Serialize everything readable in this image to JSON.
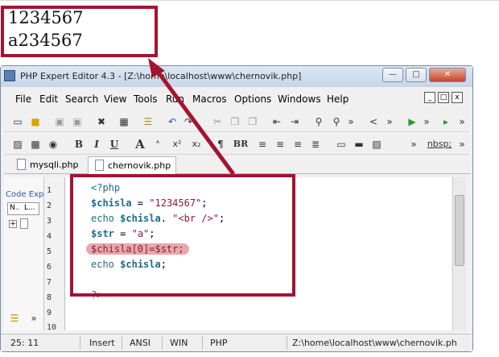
{
  "output_lines": [
    "1234567",
    "a234567"
  ],
  "window": {
    "title": "PHP Expert Editor 4.3 - [Z:\\home\\localhost\\www\\chernovik.php]",
    "controls": {
      "minimize": "—",
      "maximize": "□",
      "close": "✕"
    }
  },
  "menu": {
    "items": [
      "File",
      "Edit",
      "Search",
      "View",
      "Tools",
      "Run",
      "Macros",
      "Options",
      "Windows",
      "Help"
    ],
    "mdi": {
      "minimize": "_",
      "restore": "□",
      "close": "x"
    }
  },
  "toolbar2": {
    "bold": "B",
    "italic": "I",
    "underline": "U",
    "font_size": "A",
    "superscript": "x²",
    "subscript": "x₂",
    "paragraph": "¶",
    "br": "BR",
    "nbsp": "nbsp;"
  },
  "tabs": [
    {
      "label": "mysqli.php",
      "active": false
    },
    {
      "label": "chernovik.php",
      "active": true
    }
  ],
  "side_panel": {
    "label": "Code Exp",
    "col_n": "N..",
    "col_l": "L...",
    "expand": "+"
  },
  "line_numbers": [
    "1",
    "2",
    "3",
    "4",
    "5",
    "6",
    "7",
    "8",
    "9",
    "10"
  ],
  "code": {
    "l1": "<?php",
    "l2_var": "$chisla",
    "l2_op": " = ",
    "l2_str": "\"1234567\"",
    "l2_end": ";",
    "l3_kw": "echo",
    "l3_var": "$chisla",
    "l3_op": ". ",
    "l3_str": "\"<br />\"",
    "l3_end": ";",
    "l4_var": "$str",
    "l4_op": " = ",
    "l4_str": "\"a\"",
    "l4_end": ";",
    "l5": "$chisla[0]=$str;",
    "l6_kw": "echo",
    "l6_var": "$chisla",
    "l6_end": ";",
    "l8": "?>"
  },
  "status": {
    "position": "25: 11",
    "mode": "Insert",
    "encoding": "ANSI",
    "line_endings": "WIN",
    "language": "PHP",
    "path": "Z:\\home\\localhost\\www\\chernovik.ph"
  },
  "accent_color": "#a31431"
}
